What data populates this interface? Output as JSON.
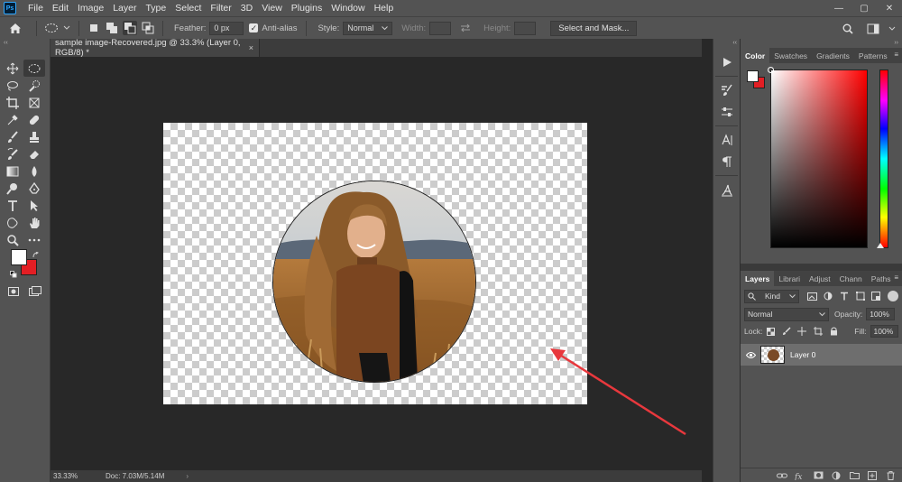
{
  "app": {
    "logo": "Ps"
  },
  "menu": [
    "File",
    "Edit",
    "Image",
    "Layer",
    "Type",
    "Select",
    "Filter",
    "3D",
    "View",
    "Plugins",
    "Window",
    "Help"
  ],
  "window_controls": {
    "minimize": "—",
    "maximize": "▢",
    "close": "✕"
  },
  "options": {
    "feather_label": "Feather:",
    "feather_value": "0 px",
    "antialias_label": "Anti-alias",
    "antialias_checked": "✓",
    "style_label": "Style:",
    "style_value": "Normal",
    "width_label": "Width:",
    "height_label": "Height:",
    "select_mask_button": "Select and Mask..."
  },
  "document": {
    "tab_title": "sample image-Recovered.jpg @ 33.3% (Layer 0, RGB/8) *",
    "tab_close": "×"
  },
  "status": {
    "zoom": "33.33%",
    "doc_info": "Doc: 7.03M/5.14M",
    "chevron": "›"
  },
  "panels": {
    "collapse_left": "‹‹",
    "collapse_right": "››",
    "color_tabs": [
      "Color",
      "Swatches",
      "Gradients",
      "Patterns"
    ],
    "layer_tabs": [
      "Layers",
      "Librari",
      "Adjust",
      "Chann",
      "Paths"
    ],
    "menu_glyph": "≡"
  },
  "layers": {
    "kind_label": "Kind",
    "blend_mode": "Normal",
    "opacity_label": "Opacity:",
    "opacity_value": "100%",
    "lock_label": "Lock:",
    "fill_label": "Fill:",
    "fill_value": "100%",
    "items": [
      {
        "name": "Layer 0",
        "visible": true
      }
    ],
    "bottom_icons": [
      "link-icon",
      "fx-icon",
      "mask-icon",
      "adjustment-icon",
      "group-icon",
      "new-layer-icon",
      "delete-icon"
    ]
  },
  "colors": {
    "foreground": "#ffffff",
    "background": "#e31e24",
    "annotation_arrow": "#e8383d"
  }
}
